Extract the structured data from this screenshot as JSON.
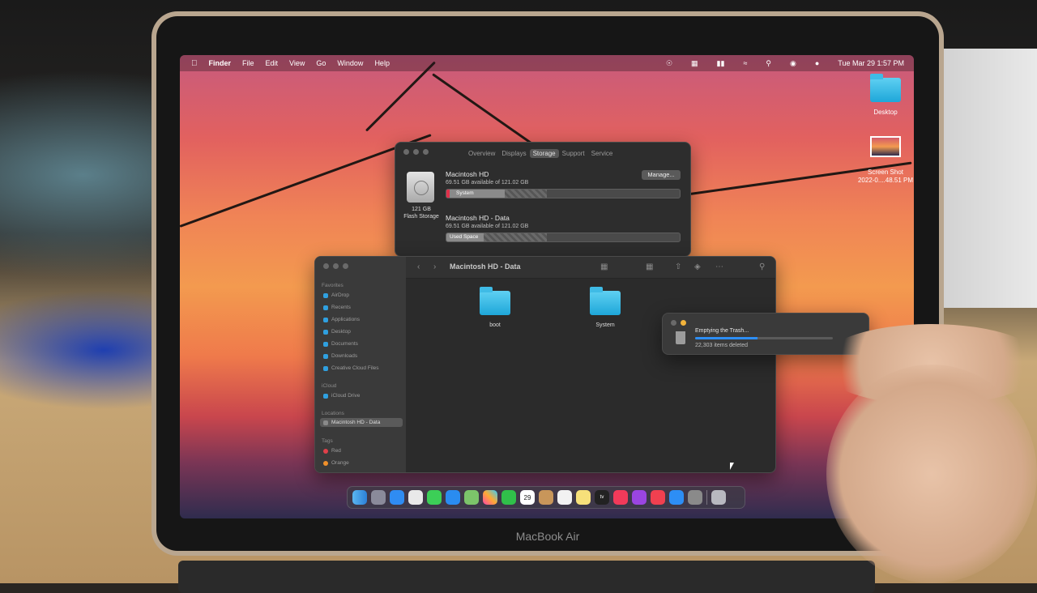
{
  "menubar": {
    "app": "Finder",
    "items": [
      "File",
      "Edit",
      "View",
      "Go",
      "Window",
      "Help"
    ],
    "datetime": "Tue Mar 29  1:57 PM"
  },
  "desktop": {
    "icons": [
      {
        "label": "Desktop"
      },
      {
        "label": "Screen Shot\n2022-0....48.51 PM"
      }
    ]
  },
  "about_this_mac": {
    "tabs": [
      "Overview",
      "Displays",
      "Storage",
      "Support",
      "Service"
    ],
    "active_tab": "Storage",
    "storage_caption": "121 GB\nFlash Storage",
    "manage_label": "Manage...",
    "drives": [
      {
        "name": "Macintosh HD",
        "available": "69.51 GB available of 121.02 GB",
        "bar_label": "System",
        "used_fraction": 0.25,
        "hatched_fraction": 0.18
      },
      {
        "name": "Macintosh HD - Data",
        "available": "69.51 GB available of 121.02 GB",
        "bar_label": "Used Space",
        "used_fraction": 0.16,
        "hatched_fraction": 0.27
      }
    ]
  },
  "finder": {
    "title": "Macintosh HD - Data",
    "sidebar": {
      "favorites_header": "Favorites",
      "favorites": [
        "AirDrop",
        "Recents",
        "Applications",
        "Desktop",
        "Documents",
        "Downloads",
        "Creative Cloud Files"
      ],
      "icloud_header": "iCloud",
      "icloud": [
        "iCloud Drive"
      ],
      "locations_header": "Locations",
      "locations": [
        "Macintosh HD - Data"
      ],
      "tags_header": "Tags",
      "tags": [
        {
          "label": "Red",
          "color": "#e0404a"
        },
        {
          "label": "Orange",
          "color": "#f0902a"
        }
      ]
    },
    "items": [
      "boot",
      "System"
    ]
  },
  "progress_dialog": {
    "title": "Emptying the Trash...",
    "subtitle": "22,303 items deleted",
    "progress_fraction": 0.45
  },
  "laptop": {
    "brand": "MacBook Air"
  },
  "dock": {
    "calendar_day": "29",
    "tv_label": "tv"
  }
}
